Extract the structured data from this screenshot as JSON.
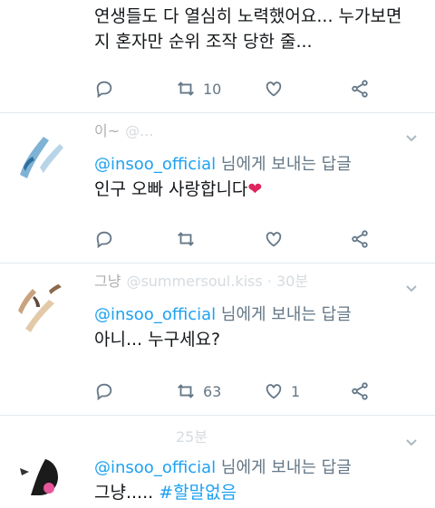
{
  "tweets": [
    {
      "lines": [
        "연생들도 다 열심히 노력했어요... 누가보면",
        "지 혼자만 순위 조작 당한 줄..."
      ],
      "retweets": "10",
      "likes": ""
    },
    {
      "header_name": "이~",
      "header_meta": "@...",
      "reply_handle": "@insoo_official",
      "reply_suffix": " 님에게 보내는 답글",
      "text": "인구 오빠 사랑합니다",
      "emoji": "❤",
      "retweets": "",
      "likes": ""
    },
    {
      "header_name": "그냥",
      "header_meta": "@summersoul.kiss · 30분",
      "reply_handle": "@insoo_official",
      "reply_suffix": " 님에게 보내는 답글",
      "text": "아니... 누구세요?",
      "retweets": "63",
      "likes": "1"
    },
    {
      "header_name": "",
      "header_meta": "25분",
      "reply_handle": "@insoo_official",
      "reply_suffix": " 님에게 보내는 답글",
      "text_prefix": "그냥..... ",
      "hashtag": "#할말없음"
    }
  ],
  "colors": {
    "accent": "#1da1f2",
    "muted": "#657786",
    "like_heart": "#e0245e",
    "divider": "#e1e8ed"
  },
  "icons": [
    "reply-icon",
    "retweet-icon",
    "like-icon",
    "share-icon",
    "chevron-down-icon"
  ]
}
